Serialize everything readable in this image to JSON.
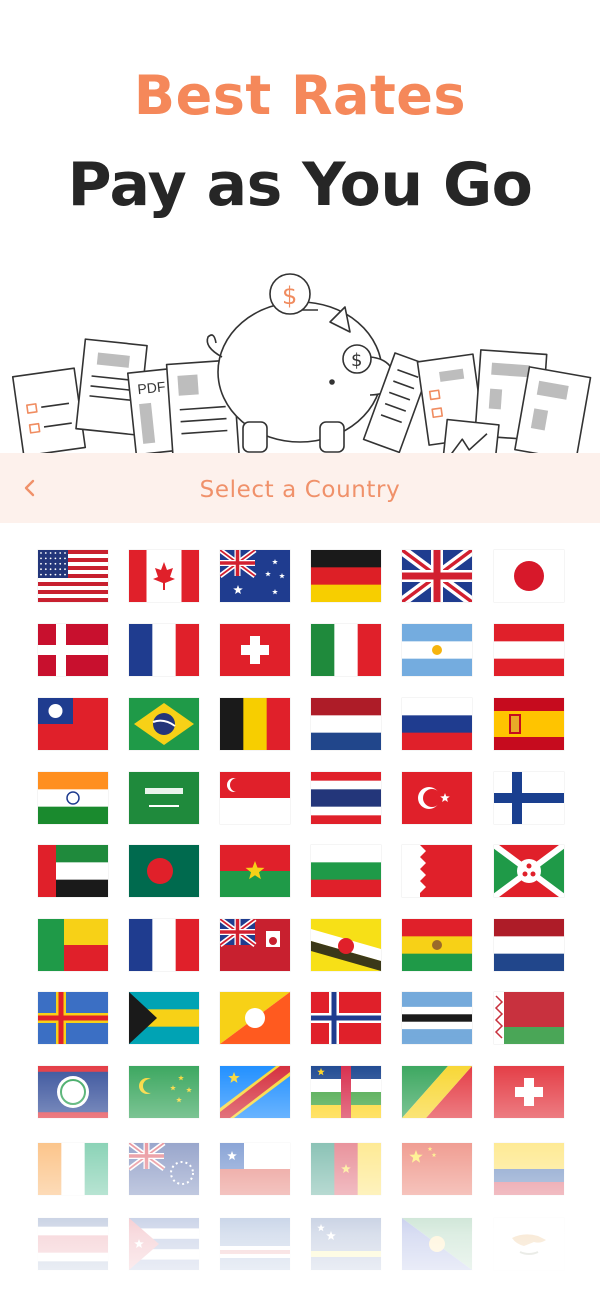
{
  "header": {
    "line1": "Best Rates",
    "line2": "Pay as You Go"
  },
  "illustration": {
    "coin_symbol": "$",
    "doc_label": "PDF"
  },
  "navbar": {
    "back_icon": "chevron-left-icon",
    "title": "Select a Country"
  },
  "colors": {
    "accent": "#f5885a",
    "headline_dark": "#262626",
    "navbar_bg": "#fdf1ec"
  },
  "flags": [
    "us",
    "ca",
    "au",
    "de",
    "gb",
    "jp",
    "dk",
    "fr",
    "ch",
    "it",
    "ar",
    "at",
    "tw",
    "br",
    "be",
    "nl",
    "ru",
    "es",
    "in",
    "sa",
    "sg",
    "th",
    "tr",
    "fi",
    "ae",
    "bd",
    "bf",
    "bg",
    "bh",
    "bi",
    "bj",
    "bl",
    "bm",
    "bn",
    "bo",
    "bq",
    "ax",
    "bs",
    "bt",
    "bv",
    "bw",
    "by",
    "bz",
    "cc",
    "cd",
    "cf",
    "cg",
    "ch2",
    "ci",
    "ck",
    "cl",
    "cm",
    "cn",
    "co",
    "cr",
    "cu",
    "cv",
    "cw",
    "cx",
    "cy"
  ]
}
